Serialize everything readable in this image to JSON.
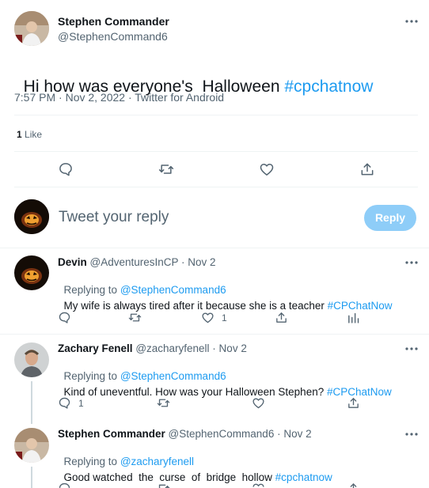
{
  "main_tweet": {
    "author_name": "Stephen Commander",
    "author_handle": "@StephenCommand6",
    "text_plain": "Hi how was everyone's  Halloween ",
    "text_hashtag": "#cpchatnow",
    "meta": "7:57 PM · Nov 2, 2022 · Twitter for Android",
    "likes_count": "1",
    "likes_label": "Like"
  },
  "reply_box": {
    "placeholder": "Tweet your reply",
    "button_label": "Reply"
  },
  "replies": [
    {
      "name": "Devin",
      "handle_date": "@AdventuresInCP · Nov 2",
      "replying_prefix": "Replying to ",
      "replying_to": "@StephenCommand6",
      "text_plain": "My wife is always tired after it because she is a teacher ",
      "text_hashtag": "#CPChatNow",
      "like_count": "1"
    },
    {
      "name": "Zachary Fenell",
      "handle_date": "@zacharyfenell · Nov 2",
      "replying_prefix": "Replying to ",
      "replying_to": "@StephenCommand6",
      "text_plain": "Kind of uneventful. How was your Halloween Stephen? ",
      "text_hashtag": "#CPChatNow",
      "reply_count": "1"
    },
    {
      "name": "Stephen Commander",
      "handle_date": "@StephenCommand6 · Nov 2",
      "replying_prefix": "Replying to ",
      "replying_to": "@zacharyfenell",
      "text_plain": "Good watched  the  curse  of  bridge  hollow ",
      "text_hashtag": "#cpchatnow"
    }
  ],
  "colors": {
    "accent": "#1d9bf0",
    "reply_button_disabled": "#8ecdf8",
    "muted_text": "#536471",
    "divider": "#eff3f4"
  },
  "icons": [
    "more-icon",
    "reply-icon",
    "retweet-icon",
    "like-icon",
    "share-icon",
    "analytics-icon"
  ]
}
